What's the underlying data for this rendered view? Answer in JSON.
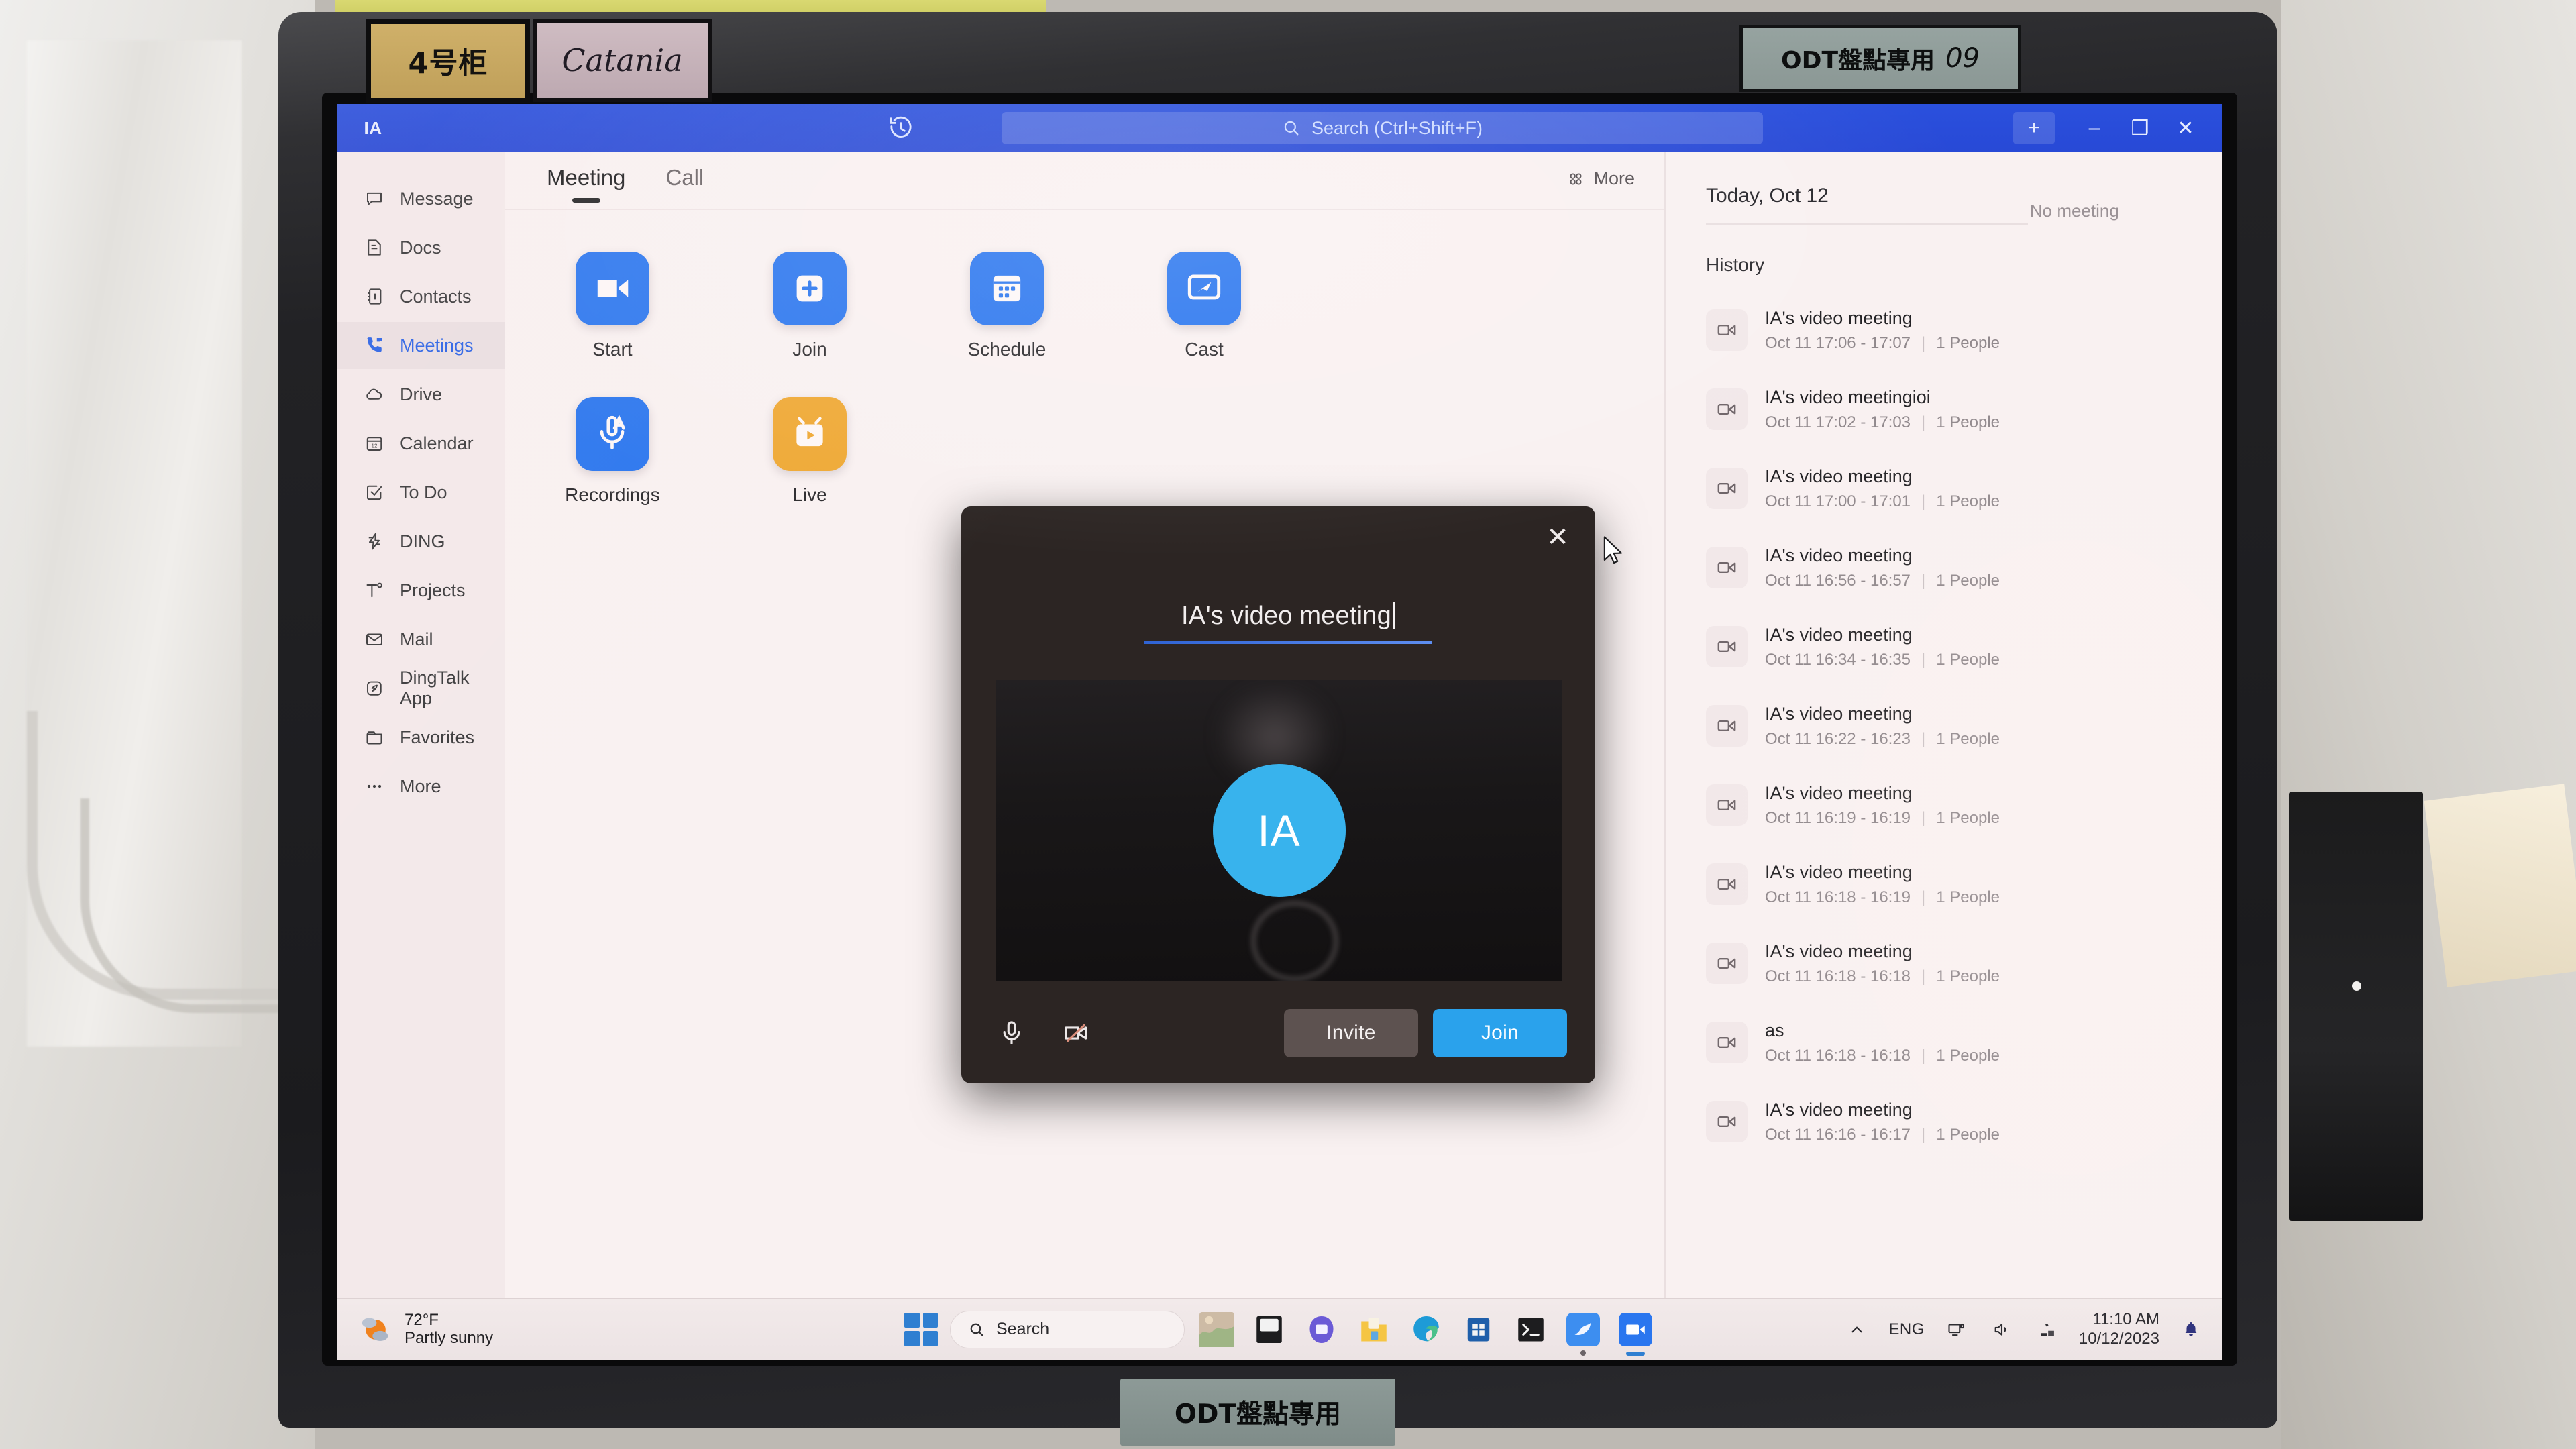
{
  "physical": {
    "label_cabinet": "4号柜",
    "label_handwritten": "Catania",
    "label_odt_top": "ODT盤點專用",
    "label_odt_top_number": "09",
    "label_odt_bottom": "ODT盤點專用"
  },
  "titlebar": {
    "avatar_initials": "IA",
    "history_icon": "history-clock-icon",
    "search_placeholder": "Search (Ctrl+Shift+F)",
    "search_icon": "search-icon",
    "add_label": "+",
    "minimize_label": "–",
    "restore_label": "❐",
    "close_label": "✕",
    "accent_color": "#2849d6"
  },
  "sidebar": {
    "items": [
      {
        "label": "Message",
        "icon": "message-bubble-icon",
        "active": false
      },
      {
        "label": "Docs",
        "icon": "document-icon",
        "active": false
      },
      {
        "label": "Contacts",
        "icon": "contacts-book-icon",
        "active": false
      },
      {
        "label": "Meetings",
        "icon": "phone-video-icon",
        "active": true
      },
      {
        "label": "Drive",
        "icon": "cloud-drive-icon",
        "active": false
      },
      {
        "label": "Calendar",
        "icon": "calendar-12-icon",
        "active": false
      },
      {
        "label": "To Do",
        "icon": "checkbox-check-icon",
        "active": false
      },
      {
        "label": "DING",
        "icon": "lightning-bolt-icon",
        "active": false
      },
      {
        "label": "Projects",
        "icon": "projects-icon",
        "active": false
      },
      {
        "label": "Mail",
        "icon": "envelope-icon",
        "active": false
      },
      {
        "label": "DingTalk App",
        "icon": "dingtalk-app-icon",
        "active": false
      },
      {
        "label": "Favorites",
        "icon": "folder-star-icon",
        "active": false
      },
      {
        "label": "More",
        "icon": "ellipsis-icon",
        "active": false
      }
    ],
    "active_color": "#2b63e6"
  },
  "main": {
    "tabs": [
      {
        "label": "Meeting",
        "active": true
      },
      {
        "label": "Call",
        "active": false
      }
    ],
    "more_label": "More",
    "more_icon": "grid-four-icon",
    "actions": [
      {
        "label": "Start",
        "icon": "video-camera-icon",
        "color": "#2a76ef"
      },
      {
        "label": "Join",
        "icon": "plus-square-icon",
        "color": "#2a76ef"
      },
      {
        "label": "Schedule",
        "icon": "calendar-grid-icon",
        "color": "#2a76ef"
      },
      {
        "label": "Cast",
        "icon": "screen-cast-icon",
        "color": "#2a76ef"
      },
      {
        "label": "Recordings",
        "icon": "mic-auto-icon",
        "color": "#2a76ef"
      },
      {
        "label": "Live",
        "icon": "tv-play-icon",
        "color": "#efa833"
      }
    ]
  },
  "history_panel": {
    "today_label": "Today, Oct 12",
    "no_meeting_label": "No meeting",
    "history_label": "History",
    "people_suffix": "1 People",
    "items": [
      {
        "title": "IA's video meeting",
        "time": "Oct 11 17:06 - 17:07",
        "people": "1 People",
        "icon": "video-camera-outline-icon"
      },
      {
        "title": "IA's video meetingioi",
        "time": "Oct 11 17:02 - 17:03",
        "people": "1 People",
        "icon": "video-camera-outline-icon"
      },
      {
        "title": "IA's video meeting",
        "time": "Oct 11 17:00 - 17:01",
        "people": "1 People",
        "icon": "video-camera-outline-icon"
      },
      {
        "title": "IA's video meeting",
        "time": "Oct 11 16:56 - 16:57",
        "people": "1 People",
        "icon": "video-camera-outline-icon"
      },
      {
        "title": "IA's video meeting",
        "time": "Oct 11 16:34 - 16:35",
        "people": "1 People",
        "icon": "video-camera-outline-icon"
      },
      {
        "title": "IA's video meeting",
        "time": "Oct 11 16:22 - 16:23",
        "people": "1 People",
        "icon": "video-camera-outline-icon"
      },
      {
        "title": "IA's video meeting",
        "time": "Oct 11 16:19 - 16:19",
        "people": "1 People",
        "icon": "video-camera-outline-icon"
      },
      {
        "title": "IA's video meeting",
        "time": "Oct 11 16:18 - 16:19",
        "people": "1 People",
        "icon": "video-camera-outline-icon"
      },
      {
        "title": "IA's video meeting",
        "time": "Oct 11 16:18 - 16:18",
        "people": "1 People",
        "icon": "video-camera-outline-icon"
      },
      {
        "title": "as",
        "time": "Oct 11 16:18 - 16:18",
        "people": "1 People",
        "icon": "video-camera-outline-icon"
      },
      {
        "title": "IA's video meeting",
        "time": "Oct 11 16:16 - 16:17",
        "people": "1 People",
        "icon": "video-camera-outline-icon"
      }
    ]
  },
  "modal": {
    "title_value": "IA's video meeting",
    "avatar_initials": "IA",
    "close_icon": "close-icon",
    "mic_icon": "microphone-on-icon",
    "camera_icon": "camera-off-icon",
    "invite_label": "Invite",
    "join_label": "Join",
    "join_color": "#2aa2ec",
    "invite_color": "#5d5250"
  },
  "taskbar": {
    "weather_temp": "72°F",
    "weather_desc": "Partly sunny",
    "weather_icon": "sun-cloud-icon",
    "start_icon": "windows-start-icon",
    "search_placeholder": "Search",
    "search_icon": "search-icon",
    "apps": [
      {
        "name": "photos-thumbnail",
        "running": false
      },
      {
        "name": "file-explorer-dark-icon",
        "running": false
      },
      {
        "name": "teams-purple-icon",
        "running": false
      },
      {
        "name": "file-explorer-icon",
        "running": false
      },
      {
        "name": "edge-browser-icon",
        "running": false
      },
      {
        "name": "microsoft-store-icon",
        "running": false
      },
      {
        "name": "terminal-icon",
        "running": false
      },
      {
        "name": "bird-app-icon",
        "running": true
      },
      {
        "name": "dingtalk-meeting-icon",
        "running": true
      }
    ],
    "tray": {
      "chevron_icon": "chevron-up-icon",
      "language": "ENG",
      "display_icon": "display-icon",
      "volume_icon": "speaker-icon",
      "network_icon": "network-icon",
      "time": "11:10 AM",
      "date": "10/12/2023",
      "bell_icon": "bell-icon"
    }
  }
}
